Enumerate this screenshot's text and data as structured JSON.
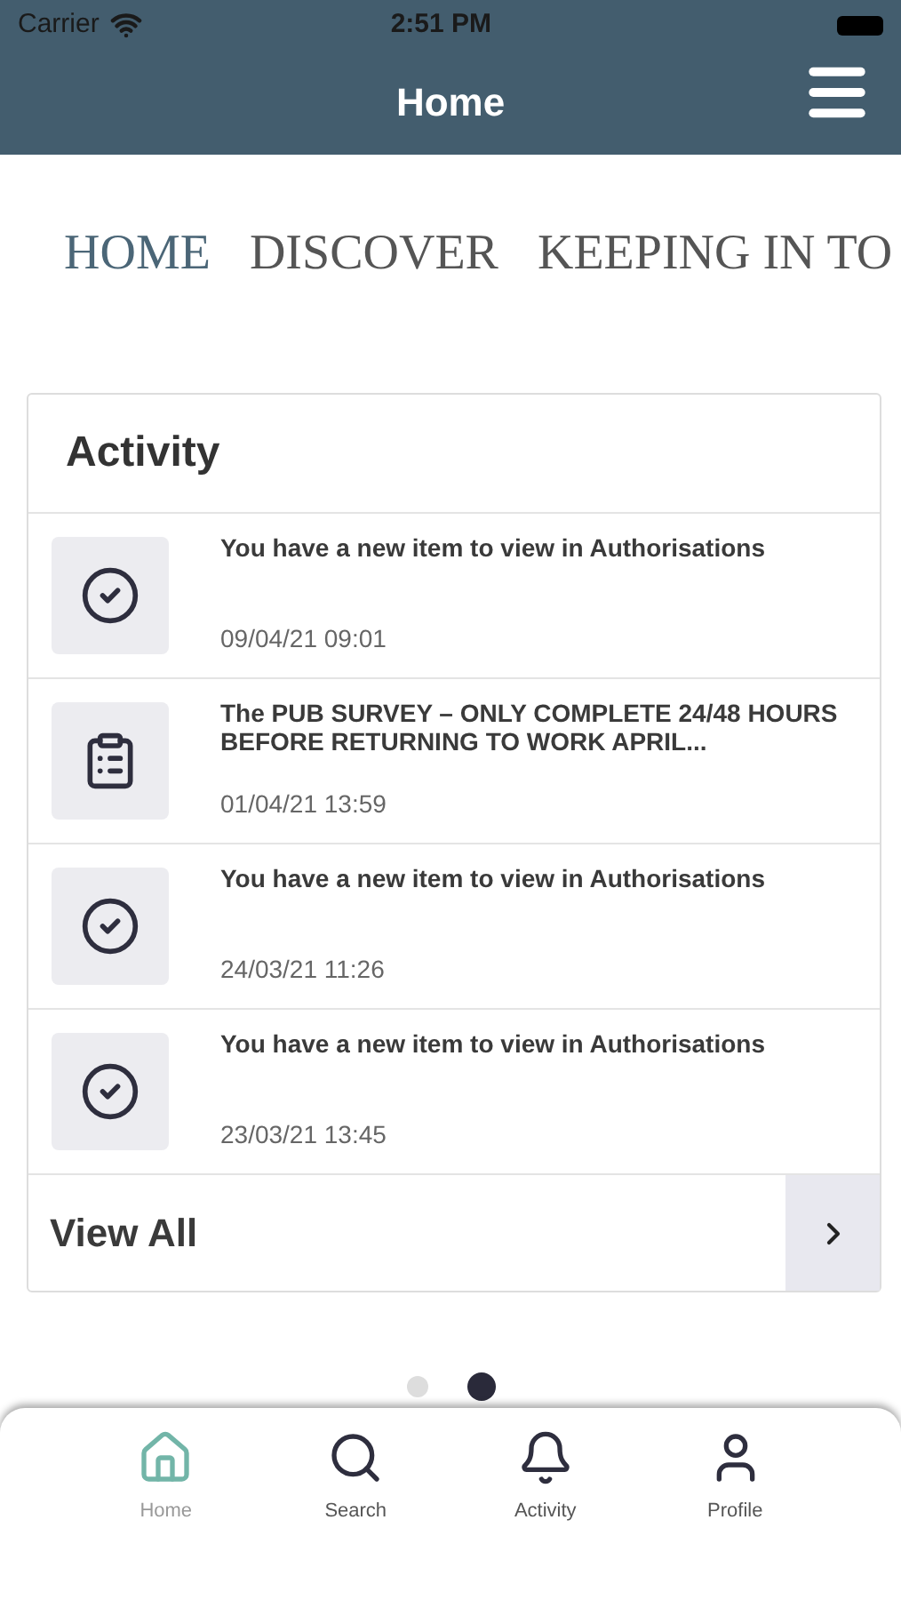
{
  "status_bar": {
    "carrier": "Carrier",
    "time": "2:51 PM"
  },
  "nav_bar": {
    "title": "Home"
  },
  "tabs": [
    {
      "label": "HOME",
      "selected": true
    },
    {
      "label": "DISCOVER",
      "selected": false
    },
    {
      "label": "KEEPING IN TO",
      "selected": false
    }
  ],
  "activity": {
    "title": "Activity",
    "items": [
      {
        "kind": "check",
        "text": "You have a new item to view in Authorisations",
        "time": "09/04/21 09:01"
      },
      {
        "kind": "clipboard",
        "text": "The PUB SURVEY – ONLY COMPLETE 24/48 HOURS BEFORE RETURNING TO WORK APRIL...",
        "time": "01/04/21 13:59"
      },
      {
        "kind": "check",
        "text": "You have a new item to view in Authorisations",
        "time": "24/03/21 11:26"
      },
      {
        "kind": "check",
        "text": "You have a new item to view in Authorisations",
        "time": "23/03/21 13:45"
      }
    ],
    "view_all": "View All"
  },
  "page_dots": [
    {
      "selected": false
    },
    {
      "selected": true
    }
  ],
  "tab_bar": [
    {
      "kind": "home",
      "label": "Home",
      "selected": true
    },
    {
      "kind": "search",
      "label": "Search",
      "selected": false
    },
    {
      "kind": "bell",
      "label": "Activity",
      "selected": false
    },
    {
      "kind": "profile",
      "label": "Profile",
      "selected": false
    }
  ]
}
